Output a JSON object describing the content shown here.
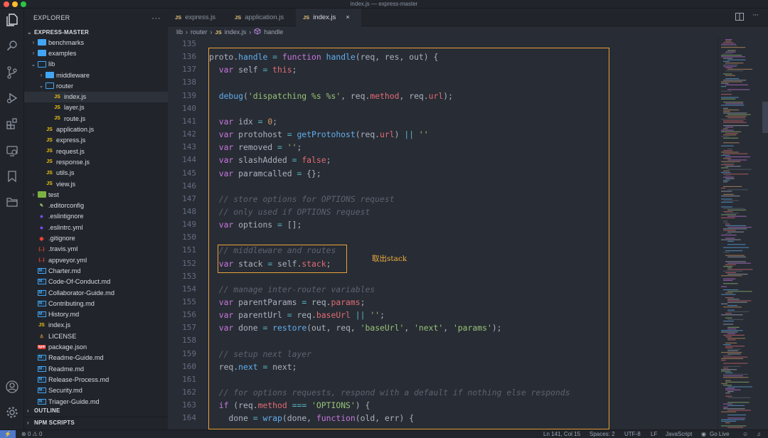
{
  "window": {
    "title": "index.js — express-master"
  },
  "colors": {
    "accent": "#e8a23a",
    "js": "#f1c40f",
    "folder": "#42a5f5",
    "statusRemote": "#4d78cc"
  },
  "activity": [
    "files-icon",
    "search-icon",
    "source-control-icon",
    "run-debug-icon",
    "extensions-icon",
    "remote-explorer-icon",
    "bookmarks-icon",
    "folder-icon",
    "account-icon",
    "settings-gear-icon"
  ],
  "sidebar": {
    "title": "EXPLORER",
    "more": "···",
    "project": "EXPRESS-MASTER",
    "items": [
      {
        "label": "benchmarks",
        "type": "folder",
        "depth": 1,
        "arrow": "›"
      },
      {
        "label": "examples",
        "type": "folder",
        "depth": 1,
        "arrow": "›"
      },
      {
        "label": "lib",
        "type": "folder-open",
        "depth": 1,
        "arrow": "⌄"
      },
      {
        "label": "middleware",
        "type": "folder",
        "depth": 2,
        "arrow": "›"
      },
      {
        "label": "router",
        "type": "folder-open",
        "depth": 2,
        "arrow": "⌄"
      },
      {
        "label": "index.js",
        "type": "js",
        "depth": 3,
        "sel": true
      },
      {
        "label": "layer.js",
        "type": "js",
        "depth": 3
      },
      {
        "label": "route.js",
        "type": "js",
        "depth": 3
      },
      {
        "label": "application.js",
        "type": "js",
        "depth": 2
      },
      {
        "label": "express.js",
        "type": "js",
        "depth": 2
      },
      {
        "label": "request.js",
        "type": "js",
        "depth": 2
      },
      {
        "label": "response.js",
        "type": "js",
        "depth": 2
      },
      {
        "label": "utils.js",
        "type": "js",
        "depth": 2
      },
      {
        "label": "view.js",
        "type": "js",
        "depth": 2
      },
      {
        "label": "test",
        "type": "folder-green",
        "depth": 1,
        "arrow": "›"
      },
      {
        "label": ".editorconfig",
        "type": "cfg",
        "depth": 1
      },
      {
        "label": ".eslintignore",
        "type": "eslint",
        "depth": 1
      },
      {
        "label": ".eslintrc.yml",
        "type": "eslint",
        "depth": 1
      },
      {
        "label": ".gitignore",
        "type": "git",
        "depth": 1
      },
      {
        "label": ".travis.yml",
        "type": "yml",
        "depth": 1
      },
      {
        "label": "appveyor.yml",
        "type": "yml",
        "depth": 1
      },
      {
        "label": "Charter.md",
        "type": "md",
        "depth": 1
      },
      {
        "label": "Code-Of-Conduct.md",
        "type": "md",
        "depth": 1
      },
      {
        "label": "Collaborator-Guide.md",
        "type": "md",
        "depth": 1
      },
      {
        "label": "Contributing.md",
        "type": "md",
        "depth": 1
      },
      {
        "label": "History.md",
        "type": "md",
        "depth": 1
      },
      {
        "label": "index.js",
        "type": "js",
        "depth": 1
      },
      {
        "label": "LICENSE",
        "type": "license",
        "depth": 1
      },
      {
        "label": "package.json",
        "type": "npm",
        "depth": 1
      },
      {
        "label": "Readme-Guide.md",
        "type": "md",
        "depth": 1
      },
      {
        "label": "Readme.md",
        "type": "md",
        "depth": 1
      },
      {
        "label": "Release-Process.md",
        "type": "md",
        "depth": 1
      },
      {
        "label": "Security.md",
        "type": "md",
        "depth": 1
      },
      {
        "label": "Triager-Guide.md",
        "type": "md",
        "depth": 1
      }
    ],
    "outline": "OUTLINE",
    "npm": "NPM SCRIPTS"
  },
  "tabs": [
    {
      "label": "express.js",
      "badge": "JS",
      "active": false
    },
    {
      "label": "application.js",
      "badge": "JS",
      "active": false
    },
    {
      "label": "index.js",
      "badge": "JS",
      "active": true,
      "close": "×"
    }
  ],
  "breadcrumb": {
    "a": "lib",
    "sep": "›",
    "b": "router",
    "c": "index.js",
    "d": "handle"
  },
  "editor": {
    "lines": [
      {
        "n": "135",
        "t": ""
      },
      {
        "n": "136",
        "t": "proto.handle = function handle(req, res, out) {"
      },
      {
        "n": "137",
        "t": "  var self = this;"
      },
      {
        "n": "138",
        "t": ""
      },
      {
        "n": "139",
        "t": "  debug('dispatching %s %s', req.method, req.url);"
      },
      {
        "n": "140",
        "t": ""
      },
      {
        "n": "141",
        "t": "  var idx = 0;"
      },
      {
        "n": "142",
        "t": "  var protohost = getProtohost(req.url) || ''"
      },
      {
        "n": "143",
        "t": "  var removed = '';"
      },
      {
        "n": "144",
        "t": "  var slashAdded = false;"
      },
      {
        "n": "145",
        "t": "  var paramcalled = {};"
      },
      {
        "n": "146",
        "t": ""
      },
      {
        "n": "147",
        "t": "  // store options for OPTIONS request"
      },
      {
        "n": "148",
        "t": "  // only used if OPTIONS request"
      },
      {
        "n": "149",
        "t": "  var options = [];"
      },
      {
        "n": "150",
        "t": ""
      },
      {
        "n": "151",
        "t": "  // middleware and routes"
      },
      {
        "n": "152",
        "t": "  var stack = self.stack;"
      },
      {
        "n": "153",
        "t": ""
      },
      {
        "n": "154",
        "t": "  // manage inter-router variables"
      },
      {
        "n": "155",
        "t": "  var parentParams = req.params;"
      },
      {
        "n": "156",
        "t": "  var parentUrl = req.baseUrl || '';"
      },
      {
        "n": "157",
        "t": "  var done = restore(out, req, 'baseUrl', 'next', 'params');"
      },
      {
        "n": "158",
        "t": ""
      },
      {
        "n": "159",
        "t": "  // setup next layer"
      },
      {
        "n": "160",
        "t": "  req.next = next;"
      },
      {
        "n": "161",
        "t": ""
      },
      {
        "n": "162",
        "t": "  // for options requests, respond with a default if nothing else responds"
      },
      {
        "n": "163",
        "t": "  if (req.method === 'OPTIONS') {"
      },
      {
        "n": "164",
        "t": "    done = wrap(done, function(old, err) {"
      }
    ],
    "annotation": "取出stack"
  },
  "status": {
    "remote": "⚡",
    "problems": "⊗ 0 ⚠ 0",
    "position": "Ln 141, Col 15",
    "spaces": "Spaces: 2",
    "encoding": "UTF-8",
    "eol": "LF",
    "language": "JavaScript",
    "golive": "Go Live"
  }
}
